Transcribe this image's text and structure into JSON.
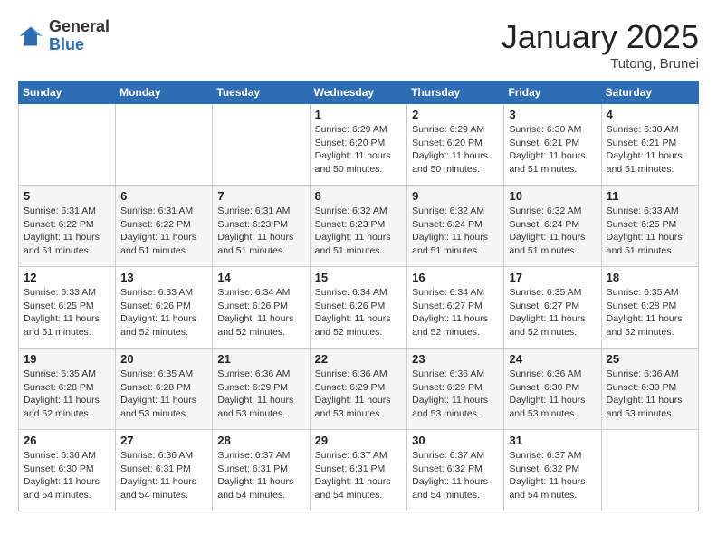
{
  "logo": {
    "general": "General",
    "blue": "Blue"
  },
  "title": "January 2025",
  "subtitle": "Tutong, Brunei",
  "weekdays": [
    "Sunday",
    "Monday",
    "Tuesday",
    "Wednesday",
    "Thursday",
    "Friday",
    "Saturday"
  ],
  "weeks": [
    [
      {
        "day": "",
        "info": ""
      },
      {
        "day": "",
        "info": ""
      },
      {
        "day": "",
        "info": ""
      },
      {
        "day": "1",
        "info": "Sunrise: 6:29 AM\nSunset: 6:20 PM\nDaylight: 11 hours\nand 50 minutes."
      },
      {
        "day": "2",
        "info": "Sunrise: 6:29 AM\nSunset: 6:20 PM\nDaylight: 11 hours\nand 50 minutes."
      },
      {
        "day": "3",
        "info": "Sunrise: 6:30 AM\nSunset: 6:21 PM\nDaylight: 11 hours\nand 51 minutes."
      },
      {
        "day": "4",
        "info": "Sunrise: 6:30 AM\nSunset: 6:21 PM\nDaylight: 11 hours\nand 51 minutes."
      }
    ],
    [
      {
        "day": "5",
        "info": "Sunrise: 6:31 AM\nSunset: 6:22 PM\nDaylight: 11 hours\nand 51 minutes."
      },
      {
        "day": "6",
        "info": "Sunrise: 6:31 AM\nSunset: 6:22 PM\nDaylight: 11 hours\nand 51 minutes."
      },
      {
        "day": "7",
        "info": "Sunrise: 6:31 AM\nSunset: 6:23 PM\nDaylight: 11 hours\nand 51 minutes."
      },
      {
        "day": "8",
        "info": "Sunrise: 6:32 AM\nSunset: 6:23 PM\nDaylight: 11 hours\nand 51 minutes."
      },
      {
        "day": "9",
        "info": "Sunrise: 6:32 AM\nSunset: 6:24 PM\nDaylight: 11 hours\nand 51 minutes."
      },
      {
        "day": "10",
        "info": "Sunrise: 6:32 AM\nSunset: 6:24 PM\nDaylight: 11 hours\nand 51 minutes."
      },
      {
        "day": "11",
        "info": "Sunrise: 6:33 AM\nSunset: 6:25 PM\nDaylight: 11 hours\nand 51 minutes."
      }
    ],
    [
      {
        "day": "12",
        "info": "Sunrise: 6:33 AM\nSunset: 6:25 PM\nDaylight: 11 hours\nand 51 minutes."
      },
      {
        "day": "13",
        "info": "Sunrise: 6:33 AM\nSunset: 6:26 PM\nDaylight: 11 hours\nand 52 minutes."
      },
      {
        "day": "14",
        "info": "Sunrise: 6:34 AM\nSunset: 6:26 PM\nDaylight: 11 hours\nand 52 minutes."
      },
      {
        "day": "15",
        "info": "Sunrise: 6:34 AM\nSunset: 6:26 PM\nDaylight: 11 hours\nand 52 minutes."
      },
      {
        "day": "16",
        "info": "Sunrise: 6:34 AM\nSunset: 6:27 PM\nDaylight: 11 hours\nand 52 minutes."
      },
      {
        "day": "17",
        "info": "Sunrise: 6:35 AM\nSunset: 6:27 PM\nDaylight: 11 hours\nand 52 minutes."
      },
      {
        "day": "18",
        "info": "Sunrise: 6:35 AM\nSunset: 6:28 PM\nDaylight: 11 hours\nand 52 minutes."
      }
    ],
    [
      {
        "day": "19",
        "info": "Sunrise: 6:35 AM\nSunset: 6:28 PM\nDaylight: 11 hours\nand 52 minutes."
      },
      {
        "day": "20",
        "info": "Sunrise: 6:35 AM\nSunset: 6:28 PM\nDaylight: 11 hours\nand 53 minutes."
      },
      {
        "day": "21",
        "info": "Sunrise: 6:36 AM\nSunset: 6:29 PM\nDaylight: 11 hours\nand 53 minutes."
      },
      {
        "day": "22",
        "info": "Sunrise: 6:36 AM\nSunset: 6:29 PM\nDaylight: 11 hours\nand 53 minutes."
      },
      {
        "day": "23",
        "info": "Sunrise: 6:36 AM\nSunset: 6:29 PM\nDaylight: 11 hours\nand 53 minutes."
      },
      {
        "day": "24",
        "info": "Sunrise: 6:36 AM\nSunset: 6:30 PM\nDaylight: 11 hours\nand 53 minutes."
      },
      {
        "day": "25",
        "info": "Sunrise: 6:36 AM\nSunset: 6:30 PM\nDaylight: 11 hours\nand 53 minutes."
      }
    ],
    [
      {
        "day": "26",
        "info": "Sunrise: 6:36 AM\nSunset: 6:30 PM\nDaylight: 11 hours\nand 54 minutes."
      },
      {
        "day": "27",
        "info": "Sunrise: 6:36 AM\nSunset: 6:31 PM\nDaylight: 11 hours\nand 54 minutes."
      },
      {
        "day": "28",
        "info": "Sunrise: 6:37 AM\nSunset: 6:31 PM\nDaylight: 11 hours\nand 54 minutes."
      },
      {
        "day": "29",
        "info": "Sunrise: 6:37 AM\nSunset: 6:31 PM\nDaylight: 11 hours\nand 54 minutes."
      },
      {
        "day": "30",
        "info": "Sunrise: 6:37 AM\nSunset: 6:32 PM\nDaylight: 11 hours\nand 54 minutes."
      },
      {
        "day": "31",
        "info": "Sunrise: 6:37 AM\nSunset: 6:32 PM\nDaylight: 11 hours\nand 54 minutes."
      },
      {
        "day": "",
        "info": ""
      }
    ]
  ]
}
